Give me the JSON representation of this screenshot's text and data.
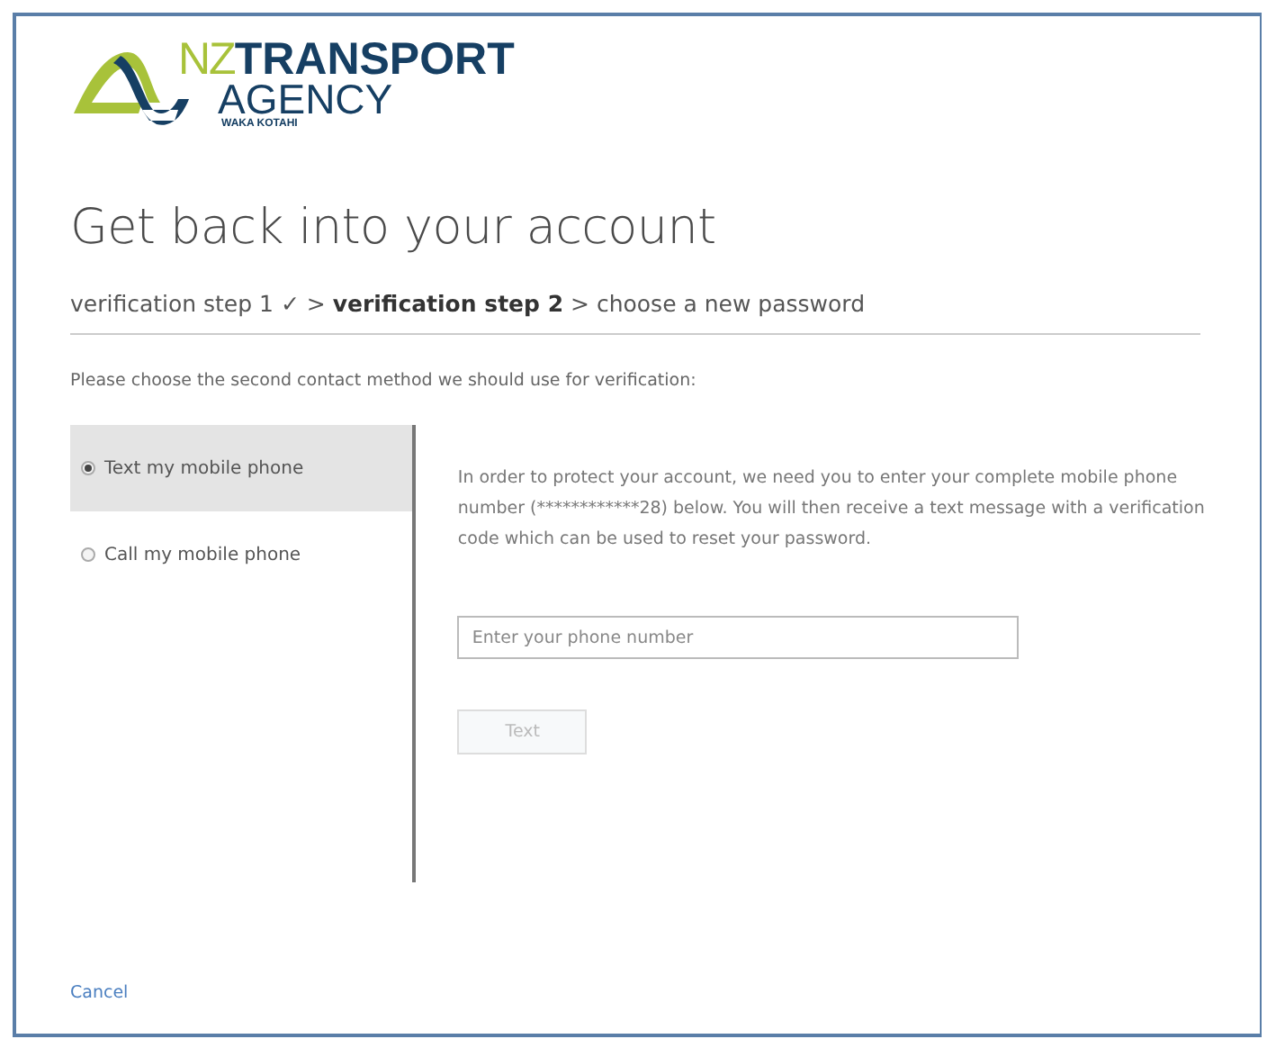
{
  "logo": {
    "prefix": "NZ",
    "line_1": "TRANSPORT",
    "line_2": "AGENCY",
    "subtitle": "WAKA KOTAHI"
  },
  "title": "Get back into your account",
  "breadcrumb": "verification step 1 ✓ > **verification step 2** > choose a new password",
  "instruction": "Please choose the second contact method we should use for verification:",
  "options": [
    {
      "label": "Text my mobile phone",
      "selected": true
    },
    {
      "label": "Call my mobile phone",
      "selected": false
    }
  ],
  "details": {
    "text": "In order to protect your account, we need you to enter your complete mobile phone number (************28) below. You will then receive a text message with a verification code which can be used to reset your password.",
    "phone_field": {
      "placeholder": "Enter your phone number"
    },
    "button": {
      "label": "Text",
      "disabled": true
    }
  },
  "cancel_link": "Cancel"
}
